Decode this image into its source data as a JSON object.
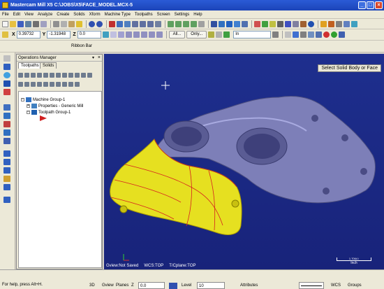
{
  "window": {
    "title": "Mastercam Mill X5  C:\\JOBS\\X5\\FACE_MODEL.MCX-5",
    "min": "_",
    "max": "□",
    "close": "×"
  },
  "menu": [
    "File",
    "Edit",
    "View",
    "Analyze",
    "Create",
    "Solids",
    "Xform",
    "Machine Type",
    "Toolpaths",
    "Screen",
    "Settings",
    "Help"
  ],
  "coords": {
    "x_label": "X",
    "x_value": "0.39732",
    "y_label": "Y",
    "y_value": "-1.31948",
    "z_label": "Z",
    "z_value": "0.0"
  },
  "toolbar2_buttons": {
    "all": "All...",
    "only": "Only...",
    "in": "In"
  },
  "ribbon": {
    "label": "Ribbon Bar"
  },
  "ops_manager": {
    "title": "Operations Manager",
    "pin": "▾",
    "close": "×",
    "tabs": [
      "Toolpaths",
      "Solids"
    ],
    "tree": {
      "machine_group": "Machine Group-1",
      "properties": "Properties - Generic Mill",
      "toolpath_group": "Toolpath Group-1"
    }
  },
  "viewport": {
    "prompt": "Select Solid Body or Face",
    "gview": "Gview:Not Saved",
    "wcs": "WCS:TOP",
    "tplane": "T/Cplane:TOP",
    "scale_value": "1.7064 i",
    "scale_unit": "Inch"
  },
  "statusbar": {
    "help": "For help, press Alt+H.",
    "mode_3d": "3D",
    "gview": "Gview",
    "planes": "Planes",
    "z_label": "Z",
    "z_value": "0.0",
    "level_label": "Level",
    "level_value": "10",
    "attributes": "Attributes",
    "wcs": "WCS",
    "groups": "Groups"
  },
  "colors": {
    "viewport_bg": "#1e2f8e",
    "part_gray": "#7d7fb8",
    "part_yellow": "#e6e020",
    "title_bar": "#2b5bd6"
  }
}
